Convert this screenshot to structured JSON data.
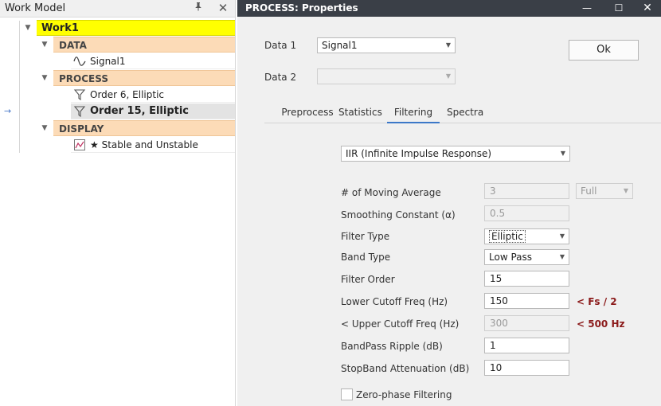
{
  "left_panel": {
    "title": "Work Model",
    "pin_icon": "pin-icon",
    "close_glyph": "✕",
    "tree": {
      "root": "Work1",
      "groups": {
        "data": {
          "label": "DATA",
          "items": [
            "Signal1"
          ]
        },
        "process": {
          "label": "PROCESS",
          "items": [
            "Order 6, Elliptic",
            "Order 15, Elliptic"
          ]
        },
        "display": {
          "label": "DISPLAY",
          "items": [
            "★ Stable and Unstable"
          ]
        }
      },
      "selected_item": "Order 15, Elliptic",
      "selection_marker": "→"
    }
  },
  "window": {
    "title": "PROCESS: Properties",
    "minimize_glyph": "—",
    "maximize_glyph": "☐",
    "close_glyph": "✕"
  },
  "form": {
    "data1_label": "Data 1",
    "data1_value": "Signal1",
    "data2_label": "Data 2",
    "data2_value": "",
    "ok_label": "Ok",
    "tabs": [
      "Preprocess",
      "Statistics",
      "Filtering",
      "Spectra"
    ],
    "active_tab": "Filtering",
    "filter_mode": "IIR (Infinite Impulse Response)",
    "moving_average_label": "# of Moving Average",
    "moving_average_value": "3",
    "moving_average_mode": "Full",
    "smoothing_label": "Smoothing Constant (α)",
    "smoothing_value": "0.5",
    "filter_type_label": "Filter Type",
    "filter_type_value": "Elliptic",
    "band_type_label": "Band Type",
    "band_type_value": "Low Pass",
    "filter_order_label": "Filter Order",
    "filter_order_value": "15",
    "lower_cutoff_label": "Lower Cutoff Freq (Hz)",
    "lower_cutoff_value": "150",
    "lower_cutoff_note": "<  Fs / 2",
    "upper_cutoff_label": "< Upper Cutoff Freq (Hz)",
    "upper_cutoff_value": "300",
    "upper_cutoff_note": "<  500 Hz",
    "bandpass_ripple_label": "BandPass Ripple (dB)",
    "bandpass_ripple_value": "1",
    "stopband_label": "StopBand Attenuation (dB)",
    "stopband_value": "10",
    "zero_phase_label": "Zero-phase Filtering",
    "zero_phase_checked": false
  },
  "colors": {
    "root_highlight": "#ffff00",
    "group_header": "#fcdbb7",
    "titlebar": "#3a3f47",
    "active_tab": "#3c78c8",
    "note_red": "#8b1a1a"
  }
}
